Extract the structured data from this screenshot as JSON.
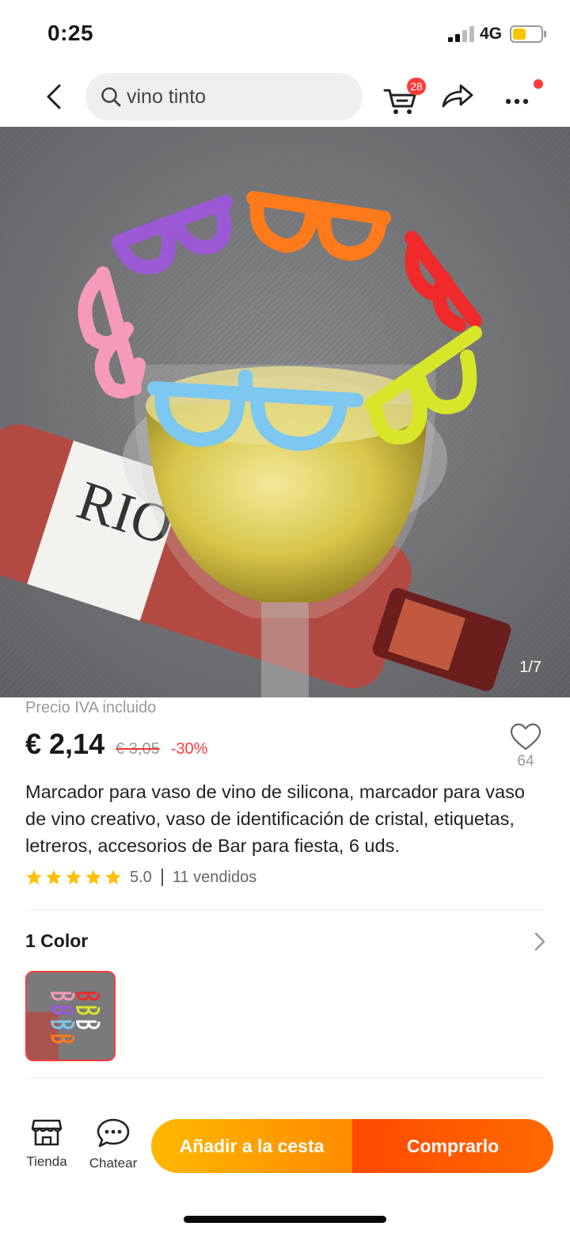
{
  "status_bar": {
    "time": "0:25",
    "network": "4G",
    "battery_color": "#f7c600"
  },
  "header": {
    "search_value": "vino tinto",
    "cart_count": "28"
  },
  "gallery": {
    "counter": "1/7",
    "glasses_colors": [
      "#9b59d6",
      "#ff7a1a",
      "#f02a2a",
      "#f59ab8",
      "#7cc8f0",
      "#d8e62a"
    ]
  },
  "product": {
    "tax_note": "Precio IVA incluido",
    "price": "€ 2,14",
    "original_price": "€ 3,05",
    "discount": "-30%",
    "wishlist_count": "64",
    "title": "Marcador para vaso de vino de silicona, marcador para vaso de vino creativo, vaso de identificación de cristal, etiquetas, letreros, accesorios de Bar para fiesta, 6 uds.",
    "rating": "5.0",
    "stars": 5,
    "sold": "11 vendidos"
  },
  "variants": {
    "label": "1 Color"
  },
  "bottom_bar": {
    "store_label": "Tienda",
    "chat_label": "Chatear",
    "add_to_cart_label": "Añadir a la cesta",
    "buy_label": "Comprarlo"
  },
  "colors": {
    "accent": "#ff3a3a",
    "star": "#ffc107"
  }
}
